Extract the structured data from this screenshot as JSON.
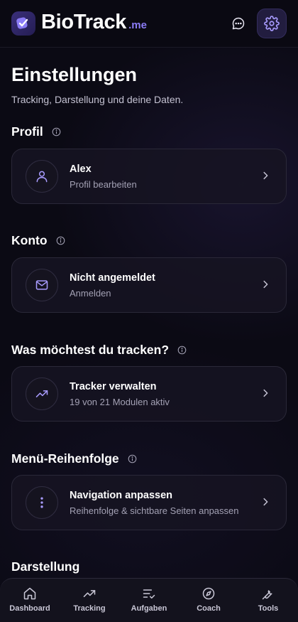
{
  "app": {
    "brand_name": "BioTrack",
    "brand_tld": ".me",
    "accent_color": "#8b7cf6"
  },
  "header": {
    "chat_icon": "chat-bubble-icon",
    "settings_icon": "gear-icon"
  },
  "page": {
    "title": "Einstellungen",
    "subtitle": "Tracking, Darstellung und deine Daten."
  },
  "sections": [
    {
      "title": "Profil",
      "card": {
        "icon": "user-icon",
        "title": "Alex",
        "subtitle": "Profil bearbeiten"
      }
    },
    {
      "title": "Konto",
      "card": {
        "icon": "mail-icon",
        "title": "Nicht angemeldet",
        "subtitle": "Anmelden"
      }
    },
    {
      "title": "Was möchtest du tracken?",
      "card": {
        "icon": "trending-up-icon",
        "title": "Tracker verwalten",
        "subtitle": "19 von 21 Modulen aktiv"
      }
    },
    {
      "title": "Menü-Reihenfolge",
      "card": {
        "icon": "more-vertical-icon",
        "title": "Navigation anpassen",
        "subtitle": "Reihenfolge & sichtbare Seiten anpassen"
      }
    },
    {
      "title": "Darstellung"
    }
  ],
  "bottom_nav": [
    {
      "label": "Dashboard",
      "icon": "home-icon"
    },
    {
      "label": "Tracking",
      "icon": "trending-up-icon"
    },
    {
      "label": "Aufgaben",
      "icon": "list-check-icon"
    },
    {
      "label": "Coach",
      "icon": "compass-icon"
    },
    {
      "label": "Tools",
      "icon": "wrench-icon"
    }
  ]
}
